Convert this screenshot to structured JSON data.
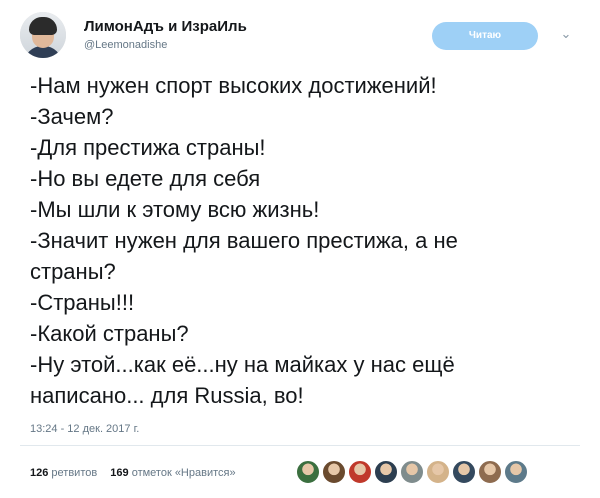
{
  "header": {
    "display_name": "ЛимонАдъ и ИзраИль",
    "handle": "@Leemonadishe",
    "follow_label": "Читаю",
    "caret_icon": "chevron-down-icon"
  },
  "tweet": {
    "lines": [
      "-Нам нужен спорт высоких достижений!",
      "-Зачем?",
      "-Для престижа страны!",
      "-Но вы едете для себя",
      "-Мы шли к этому всю жизнь!",
      "-Значит нужен для вашего престижа, а не",
      "страны?",
      "-Страны!!!",
      "-Какой страны?",
      "-Ну этой...как её...ну на майках у нас ещё",
      "написано... для Russia, во!"
    ],
    "timestamp": "13:24 - 12 дек. 2017 г."
  },
  "stats": {
    "retweets_count": "126",
    "retweets_label": "ретвитов",
    "likes_count": "169",
    "likes_label": "отметок «Нравится»"
  },
  "liker_avatars": [
    {
      "color": "#3b6f3f"
    },
    {
      "color": "#6a4a2e"
    },
    {
      "color": "#c0392b"
    },
    {
      "color": "#2c3e50"
    },
    {
      "color": "#7f8c8d"
    },
    {
      "color": "#d4b38a"
    },
    {
      "color": "#34495e"
    },
    {
      "color": "#8e6b4f"
    },
    {
      "color": "#5d7a8a"
    }
  ],
  "colors": {
    "accent": "#9ed0f6",
    "text": "#14171a",
    "secondary": "#657786"
  }
}
